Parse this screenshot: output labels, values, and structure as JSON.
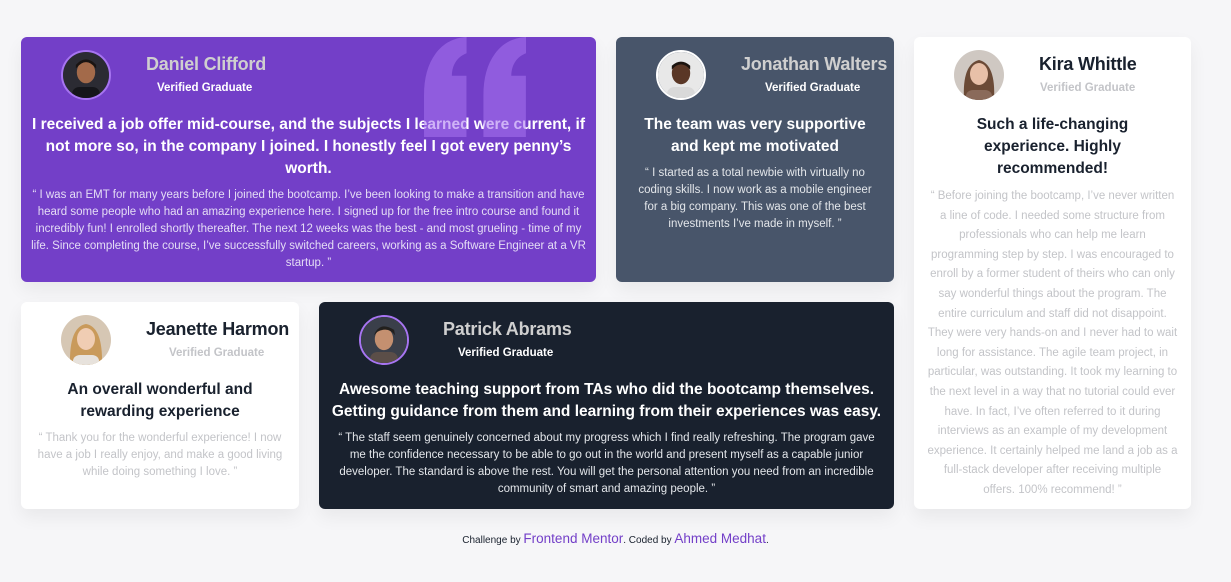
{
  "testimonials": [
    {
      "name": "Daniel Clifford",
      "role": "Verified Graduate",
      "headline": "I received a job offer mid-course, and the subjects I learned were current, if not more so, in the company I joined. I honestly feel I got every penny’s worth.",
      "quote": "“ I was an EMT for many years before I joined the bootcamp. I’ve been looking to make a transition and have heard some people who had an amazing experience here. I signed up for the free intro course and found it incredibly fun! I enrolled shortly thereafter. The next 12 weeks was the best - and most grueling - time of my life. Since completing the course, I’ve successfully switched careers, working as a Software Engineer at a VR startup. ”",
      "bg_color": "#733fc8"
    },
    {
      "name": "Jonathan Walters",
      "role": "Verified Graduate",
      "headline": "The team was very supportive and kept me motivated",
      "quote": "“ I started as a total newbie with virtually no coding skills. I now work as a mobile engineer for a big company. This was one of the best investments I’ve made in myself. ”",
      "bg_color": "#48556a"
    },
    {
      "name": "Kira Whittle",
      "role": "Verified Graduate",
      "headline": "Such a life-changing experience. Highly recommended!",
      "quote": "“ Before joining the bootcamp, I’ve never written a line of code. I needed some structure from professionals who can help me learn programming step by step. I was encouraged to enroll by a former student of theirs who can only say wonderful things about the program. The entire curriculum and staff did not disappoint. They were very hands-on and I never had to wait long for assistance. The agile team project, in particular, was outstanding. It took my learning to the next level in a way that no tutorial could ever have. In fact, I’ve often referred to it during interviews as an example of my development experience. It certainly helped me land a job as a full-stack developer after receiving multiple offers. 100% recommend! ”",
      "bg_color": "#ffffff"
    },
    {
      "name": "Jeanette Harmon",
      "role": "Verified Graduate",
      "headline": "An overall wonderful and rewarding experience",
      "quote": "“ Thank you for the wonderful experience! I now have a job I really enjoy, and make a good living while doing something I love. ”",
      "bg_color": "#ffffff"
    },
    {
      "name": "Patrick Abrams",
      "role": "Verified Graduate",
      "headline": "Awesome teaching support from TAs who did the bootcamp themselves. Getting guidance from them and learning from their experiences was easy.",
      "quote": "“ The staff seem genuinely concerned about my progress which I find really refreshing. The program gave me the confidence necessary to be able to go out in the world and present myself as a capable junior developer. The standard is above the rest. You will get the personal attention you need from an incredible community of smart and amazing people. ”",
      "bg_color": "#19212e"
    }
  ],
  "attribution": {
    "challenge_prefix": "Challenge by",
    "challenge_link": "Frontend Mentor",
    "coded_prefix": ". Coded by",
    "coded_link": "Ahmed Medhat",
    "suffix": "."
  },
  "icons": {
    "quote_decoration": "quote-mark-icon",
    "avatars": "avatar-photo"
  },
  "colors": {
    "page_bg": "#f6f6f8",
    "accent_purple": "#733fc8",
    "link_color": "#733fc8"
  }
}
